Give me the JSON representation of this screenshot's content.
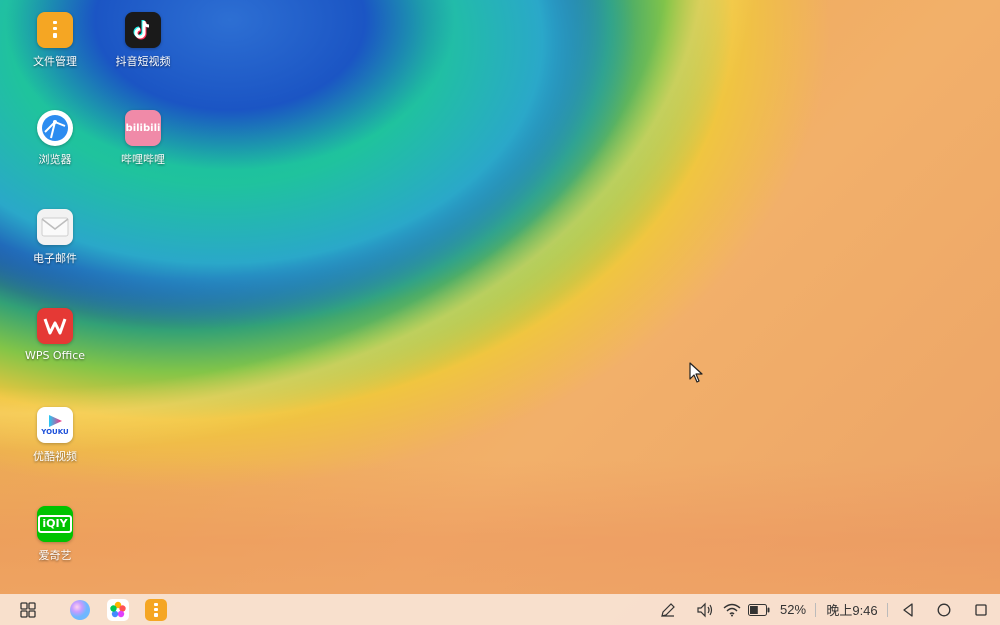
{
  "desktop": {
    "icons": [
      {
        "label": "文件管理",
        "icon": "file-manager-icon"
      },
      {
        "label": "抖音短视频",
        "icon": "tiktok-icon"
      },
      {
        "label": "浏览器",
        "icon": "browser-icon"
      },
      {
        "label": "哔哩哔哩",
        "icon": "bilibili-icon",
        "icon_text": "bilibili"
      },
      {
        "label": "电子邮件",
        "icon": "email-icon"
      },
      {
        "label": "WPS Office",
        "icon": "wps-icon"
      },
      {
        "label": "优酷视频",
        "icon": "youku-icon",
        "icon_text": "YOUKU"
      },
      {
        "label": "爱奇艺",
        "icon": "iqiyi-icon",
        "icon_text": "iQIY"
      }
    ]
  },
  "taskbar": {
    "apps": [
      "app-launcher-icon",
      "assistant-icon",
      "gallery-icon",
      "file-manager-icon"
    ],
    "tray": {
      "battery_percent": "52%",
      "battery_level": 0.52,
      "clock": "晚上9:46"
    },
    "nav": [
      "back-icon",
      "home-icon",
      "recents-icon"
    ]
  },
  "colors": {
    "file_manager": "#f5a623",
    "tiktok": "#1a1a1a",
    "browser": "#2c8cf0",
    "bilibili": "#f08aa8",
    "email": "#f2f2f2",
    "wps": "#e53935",
    "youku": "#ffffff",
    "iqiyi": "#00c300"
  }
}
